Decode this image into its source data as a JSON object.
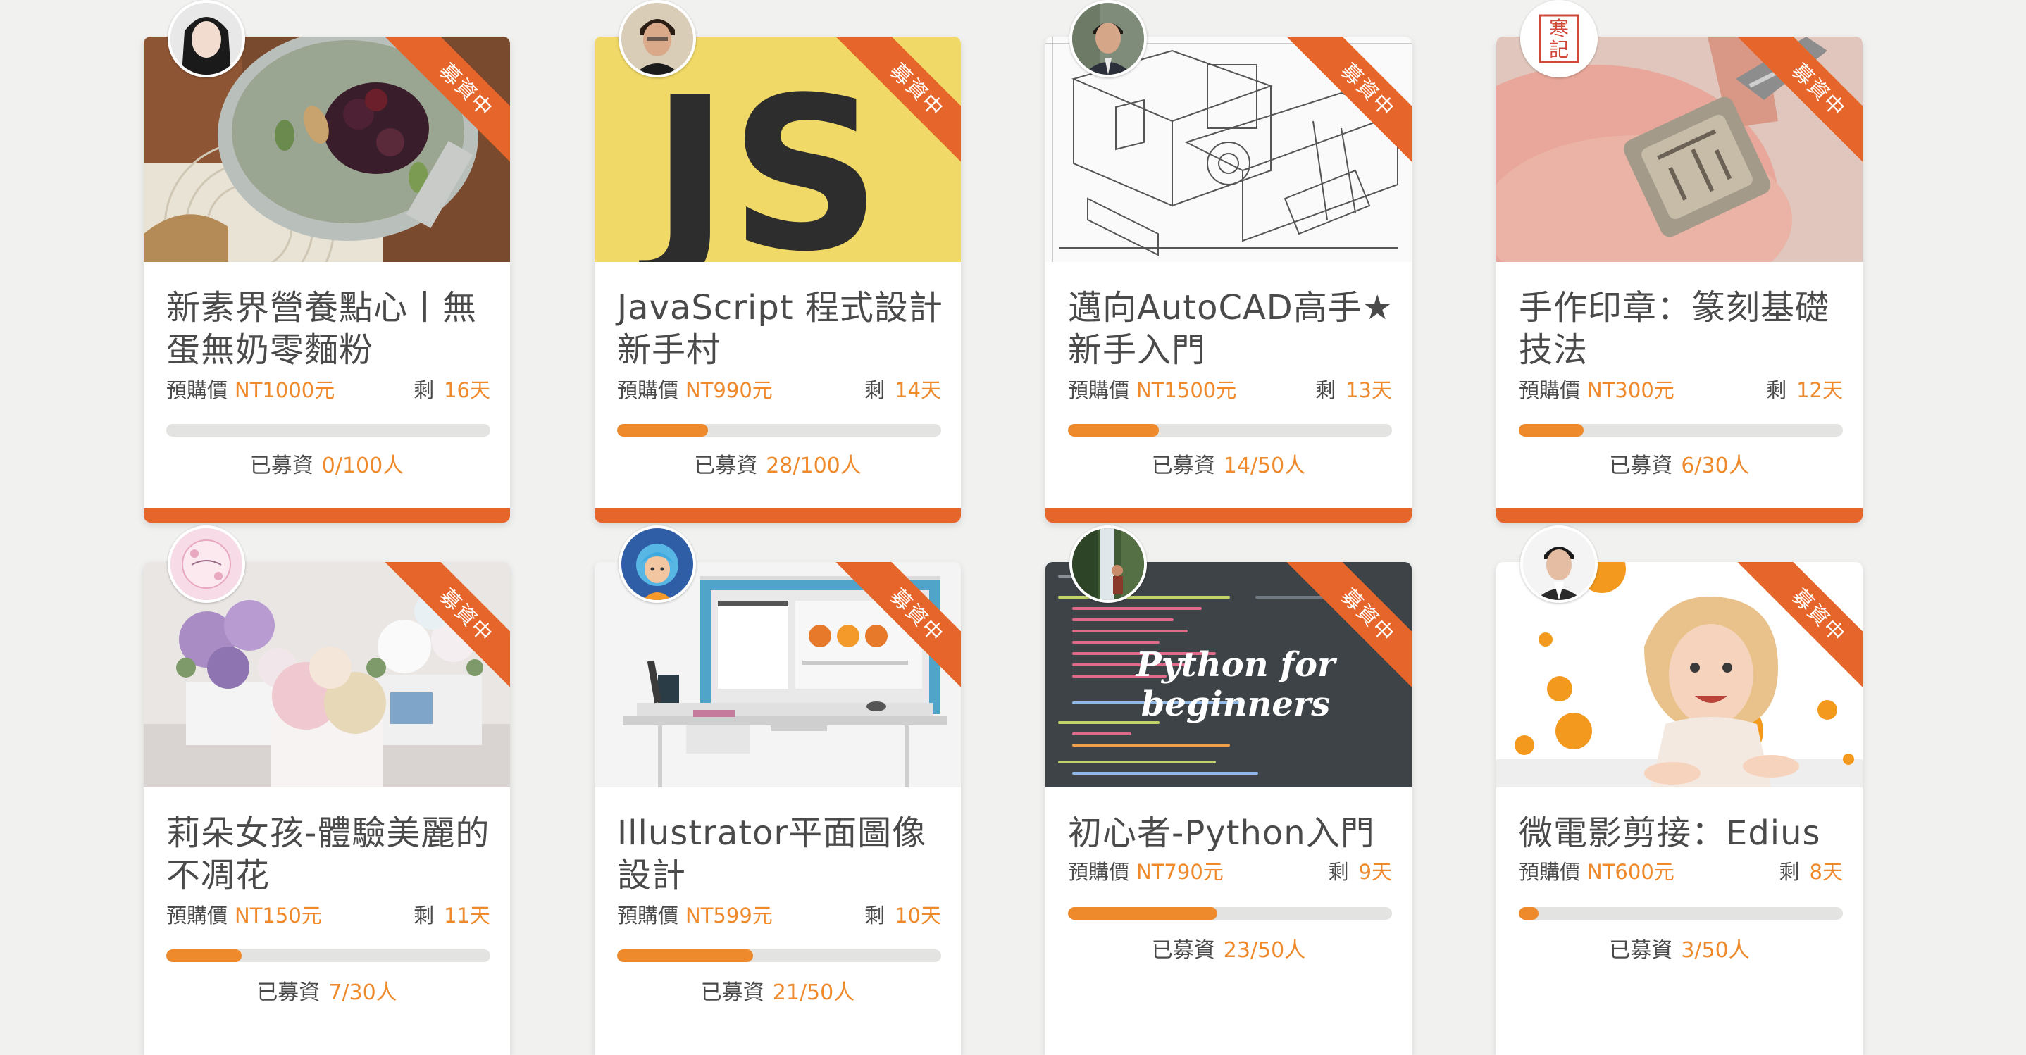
{
  "ribbon_label": "募資中",
  "price_label": "預購價",
  "days_label": "剩",
  "raised_label": "已募資",
  "colors": {
    "accent": "#ef8a2c",
    "ribbon": "#e5652a",
    "text": "#4a4a4a",
    "track": "#e3e3e1"
  },
  "courses": [
    {
      "title": "新素界營養點心丨無蛋無奶零麵粉",
      "price": "NT1000元",
      "days": "16天",
      "raised": "0/100人",
      "progress": 0.0,
      "thumb_icon": "vegan-dessert-jar-photo",
      "avatar_icon": "woman-portrait-avatar"
    },
    {
      "title": "JavaScript 程式設計新手村",
      "price": "NT990元",
      "days": "14天",
      "raised": "28/100人",
      "progress": 0.28,
      "thumb_icon": "javascript-logo",
      "avatar_icon": "man-portrait-avatar"
    },
    {
      "title": "邁向AutoCAD高手★新手入門",
      "price": "NT1500元",
      "days": "13天",
      "raised": "14/50人",
      "progress": 0.28,
      "thumb_icon": "cad-technical-drawing",
      "avatar_icon": "man-suit-avatar"
    },
    {
      "title": "手作印章：篆刻基礎技法",
      "price": "NT300元",
      "days": "12天",
      "raised": "6/30人",
      "progress": 0.2,
      "thumb_icon": "seal-carving-photo",
      "avatar_icon": "seal-stamp-avatar",
      "avatar_text": "寒記"
    },
    {
      "title": "莉朵女孩-體驗美麗的不凋花",
      "price": "NT150元",
      "days": "11天",
      "raised": "7/30人",
      "progress": 0.233,
      "thumb_icon": "preserved-flowers-photo",
      "avatar_icon": "floral-logo-avatar"
    },
    {
      "title": "Illustrator平面圖像設計",
      "price": "NT599元",
      "days": "10天",
      "raised": "21/50人",
      "progress": 0.42,
      "thumb_icon": "desk-computer-illustration",
      "avatar_icon": "cartoon-girl-avatar"
    },
    {
      "title": "初心者-Python入門",
      "price": "NT790元",
      "days": "9天",
      "raised": "23/50人",
      "progress": 0.46,
      "thumb_icon": "python-code-banner",
      "thumb_text": "Python for beginners",
      "avatar_icon": "waterfall-person-avatar"
    },
    {
      "title": "微電影剪接：Edius",
      "price": "NT600元",
      "days": "8天",
      "raised": "3/50人",
      "progress": 0.06,
      "thumb_icon": "girl-with-oranges-photo",
      "avatar_icon": "young-man-avatar"
    }
  ]
}
